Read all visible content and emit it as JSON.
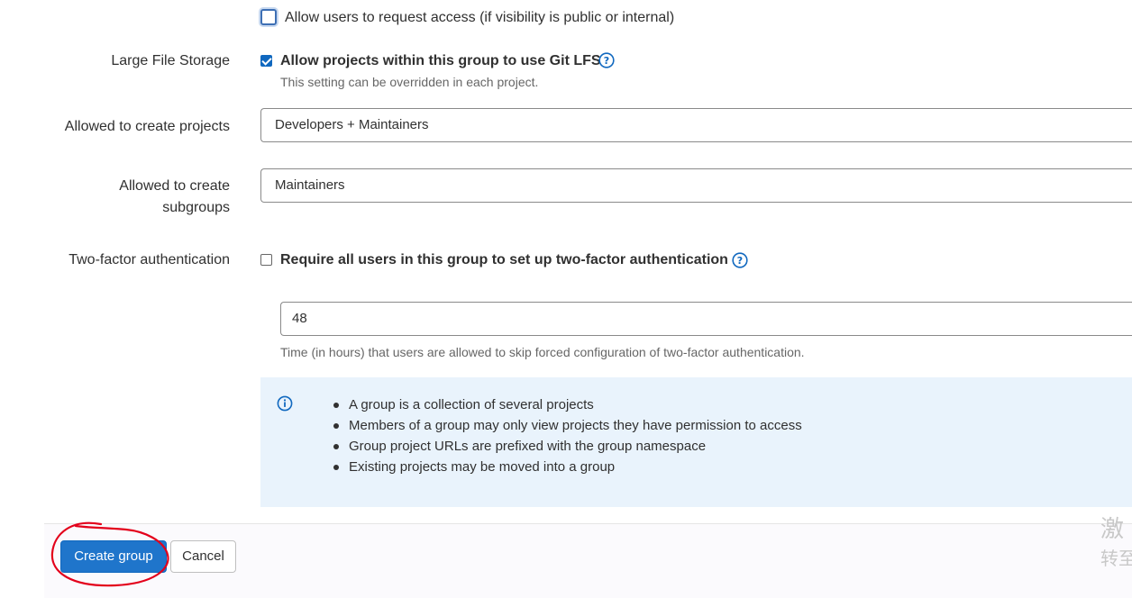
{
  "request_access": {
    "label": "Allow users to request access (if visibility is public or internal)",
    "checked": false
  },
  "lfs": {
    "section_label": "Large File Storage",
    "checkbox_label": "Allow projects within this group to use Git LFS",
    "help_text": "This setting can be overridden in each project.",
    "checked": true
  },
  "create_projects": {
    "label": "Allowed to create projects",
    "value": "Developers + Maintainers"
  },
  "create_subgroups": {
    "label_line1": "Allowed to create",
    "label_line2": "subgroups",
    "value": "Maintainers"
  },
  "two_factor": {
    "section_label": "Two-factor authentication",
    "checkbox_label": "Require all users in this group to set up two-factor authentication",
    "checked": false,
    "grace_period_value": "48",
    "grace_period_help": "Time (in hours) that users are allowed to skip forced configuration of two-factor authentication."
  },
  "info": {
    "items": [
      "A group is a collection of several projects",
      "Members of a group may only view projects they have permission to access",
      "Group project URLs are prefixed with the group namespace",
      "Existing projects may be moved into a group"
    ]
  },
  "footer": {
    "create_label": "Create group",
    "cancel_label": "Cancel"
  },
  "watermark": {
    "line1": "激",
    "line2": "转至"
  },
  "colors": {
    "primary": "#1f75cb",
    "info_bg": "#e9f3fc",
    "annotation": "#e3001b"
  }
}
